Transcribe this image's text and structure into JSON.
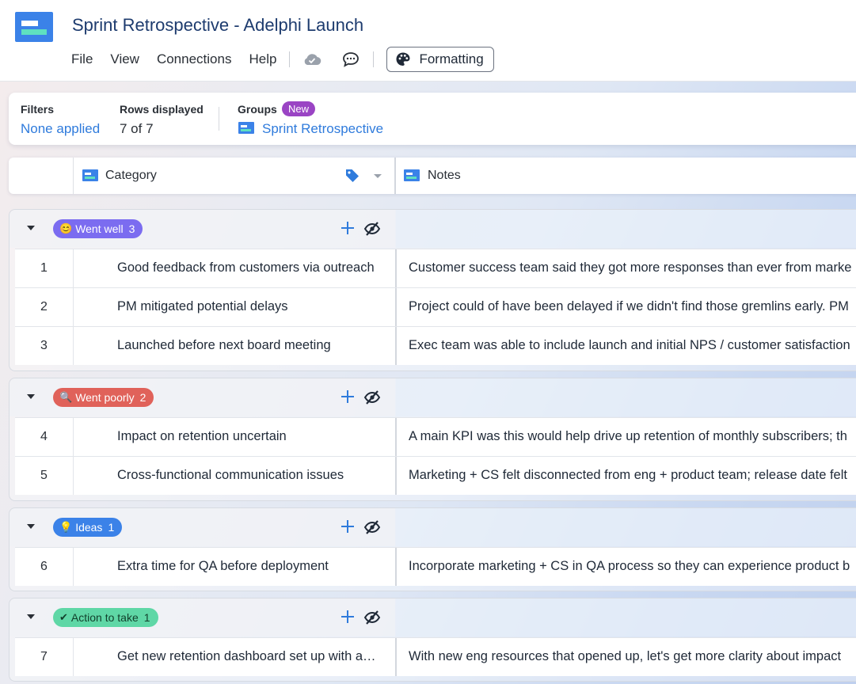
{
  "header": {
    "title": "Sprint Retrospective - Adelphi Launch",
    "menu": [
      {
        "label": "File",
        "name": "menu-file"
      },
      {
        "label": "View",
        "name": "menu-view"
      },
      {
        "label": "Connections",
        "name": "menu-connections"
      },
      {
        "label": "Help",
        "name": "menu-help"
      }
    ],
    "icons": [
      "cloud-icon",
      "comment-icon",
      "palette-icon"
    ],
    "formatting_label": "Formatting"
  },
  "filters": {
    "filters_label": "Filters",
    "filters_value": "None applied",
    "rows_label": "Rows displayed",
    "rows_value": "7 of 7",
    "groups_label": "Groups",
    "groups_badge": "New",
    "groups_value": "Sprint Retrospective"
  },
  "columns": {
    "category": "Category",
    "notes": "Notes"
  },
  "colors": {
    "accent": "#2f7bdc",
    "went_well": "#7b6cf0",
    "went_poorly": "#e0625a",
    "ideas": "#3b82e8",
    "action_to_take": "#5fd7a6"
  },
  "groups": [
    {
      "label": "Went well",
      "emoji": "😊",
      "count": "3",
      "rows": [
        {
          "num": "1",
          "category": "Good feedback from customers via outreach",
          "notes": "Customer success team said they got more responses than ever from marke"
        },
        {
          "num": "2",
          "category": "PM mitigated potential delays",
          "notes": "Project could of have been delayed if we didn't find those gremlins early. PM"
        },
        {
          "num": "3",
          "category": "Launched before next board meeting",
          "notes": "Exec team was able to include launch and initial NPS / customer satisfaction"
        }
      ]
    },
    {
      "label": "Went poorly",
      "emoji": "🔍",
      "count": "2",
      "rows": [
        {
          "num": "4",
          "category": "Impact on retention uncertain",
          "notes": "A main KPI was this would help drive up retention of monthly subscribers; th"
        },
        {
          "num": "5",
          "category": "Cross-functional communication issues",
          "notes": "Marketing + CS felt disconnected from eng + product team; release date felt"
        }
      ]
    },
    {
      "label": "Ideas",
      "emoji": "💡",
      "count": "1",
      "rows": [
        {
          "num": "6",
          "category": "Extra time for QA before deployment",
          "notes": "Incorporate marketing + CS in QA process so they can experience product b"
        }
      ]
    },
    {
      "label": "Action to take",
      "emoji": "✔",
      "count": "1",
      "rows": [
        {
          "num": "7",
          "category": "Get new retention dashboard set up with analytics",
          "notes": "With new eng resources that opened up, let's get more clarity about impact"
        }
      ]
    }
  ]
}
